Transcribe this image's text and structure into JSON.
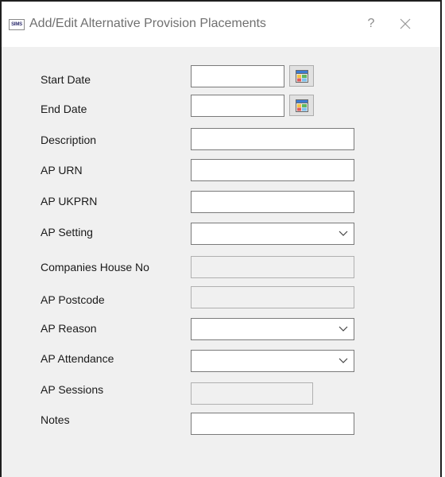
{
  "window": {
    "app_icon_text": "SIMS",
    "title": "Add/Edit Alternative Provision Placements",
    "help_glyph": "?"
  },
  "icons": {
    "app": "sims-app-icon",
    "help": "help-icon",
    "close": "close-icon",
    "calendar": "calendar-icon",
    "dropdown": "chevron-down-icon"
  },
  "form": {
    "start_date": {
      "label": "Start Date",
      "value": ""
    },
    "end_date": {
      "label": "End Date",
      "value": ""
    },
    "description": {
      "label": "Description",
      "value": ""
    },
    "ap_urn": {
      "label": "AP URN",
      "value": ""
    },
    "ap_ukprn": {
      "label": "AP UKPRN",
      "value": ""
    },
    "ap_setting": {
      "label": "AP Setting",
      "selected": ""
    },
    "companies_house_no": {
      "label": "Companies House No",
      "value": ""
    },
    "ap_postcode": {
      "label": "AP Postcode",
      "value": ""
    },
    "ap_reason": {
      "label": "AP Reason",
      "selected": ""
    },
    "ap_attendance": {
      "label": "AP Attendance",
      "selected": ""
    },
    "ap_sessions": {
      "label": "AP Sessions",
      "value": ""
    },
    "notes": {
      "label": "Notes",
      "value": ""
    }
  }
}
